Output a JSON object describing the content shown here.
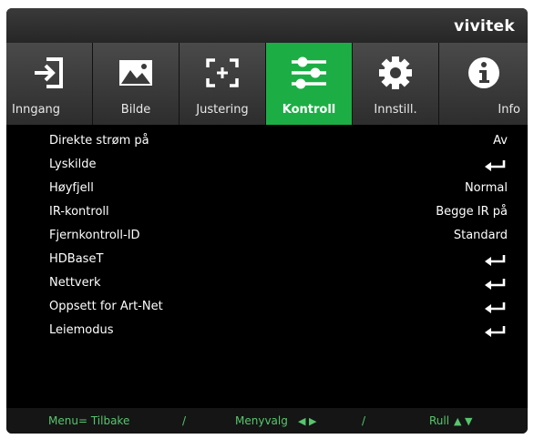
{
  "brand": "vivitek",
  "tabs": [
    {
      "label": "Inngang",
      "icon": "input-icon",
      "active": false
    },
    {
      "label": "Bilde",
      "icon": "image-icon",
      "active": false
    },
    {
      "label": "Justering",
      "icon": "adjust-frame-icon",
      "active": false
    },
    {
      "label": "Kontroll",
      "icon": "sliders-icon",
      "active": true
    },
    {
      "label": "Innstill.",
      "icon": "gear-icon",
      "active": false
    },
    {
      "label": "Info",
      "icon": "info-icon",
      "active": false
    }
  ],
  "menu": {
    "rows": [
      {
        "name": "Direkte strøm på",
        "value": "Av"
      },
      {
        "name": "Lyskilde",
        "value": "",
        "enter": true
      },
      {
        "name": "Høyfjell",
        "value": "Normal"
      },
      {
        "name": "IR-kontroll",
        "value": "Begge IR på"
      },
      {
        "name": "Fjernkontroll-ID",
        "value": "Standard"
      },
      {
        "name": "HDBaseT",
        "value": "",
        "enter": true
      },
      {
        "name": "Nettverk",
        "value": "",
        "enter": true
      },
      {
        "name": "Oppsett for Art-Net",
        "value": "",
        "enter": true
      },
      {
        "name": "Leiemodus",
        "value": "",
        "enter": true
      }
    ]
  },
  "footer": {
    "back": "Menu= Tilbake",
    "sep": "/",
    "select": "Menyvalg",
    "scroll": "Rull"
  },
  "colors": {
    "accent": "#1cae45",
    "footer_text": "#57c66d"
  }
}
